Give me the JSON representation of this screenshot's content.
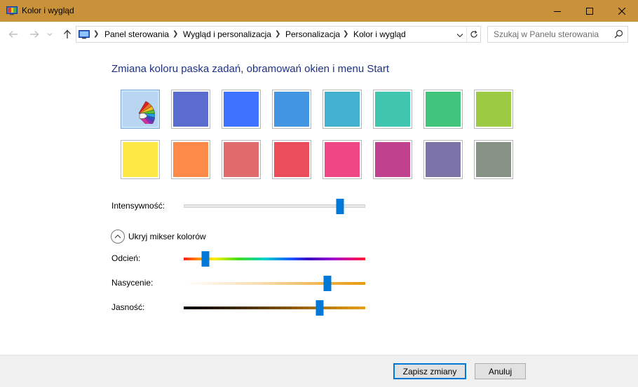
{
  "window": {
    "title": "Kolor i wygląd",
    "accent_color": "#c9923a"
  },
  "navigation": {
    "breadcrumbs": [
      "Panel sterowania",
      "Wygląd i personalizacja",
      "Personalizacja",
      "Kolor i wygląd"
    ],
    "search_placeholder": "Szukaj w Panelu sterowania",
    "search_value": ""
  },
  "main": {
    "heading": "Zmiana koloru paska zadań, obramowań okien i menu Start",
    "swatches_row1": [
      "auto",
      "#5b6ccf",
      "#3f72ff",
      "#4295e0",
      "#43b0cf",
      "#40c6af",
      "#41c57c",
      "#9cca42"
    ],
    "swatches_row2": [
      "#fde744",
      "#fe8a4a",
      "#e06b6d",
      "#ec4d5b",
      "#ef4685",
      "#c0428e",
      "#7c73a9",
      "#869284"
    ],
    "selected_swatch": "auto",
    "intensity_label": "Intensywność:",
    "intensity_value": 0.86,
    "mixer_toggle_label": "Ukryj mikser kolorów",
    "hue_label": "Odcień:",
    "hue_value": 0.12,
    "saturation_label": "Nasycenie:",
    "saturation_value": 0.79,
    "lightness_label": "Jasność:",
    "lightness_value": 0.75
  },
  "footer": {
    "save_label": "Zapisz zmiany",
    "cancel_label": "Anuluj"
  },
  "icons": {
    "app": "color-appearance-icon",
    "minimize": "minimize-icon",
    "maximize": "maximize-icon",
    "close": "close-icon",
    "back": "back-arrow-icon",
    "forward": "forward-arrow-icon",
    "up": "up-arrow-icon",
    "refresh": "refresh-icon",
    "search": "search-icon"
  }
}
